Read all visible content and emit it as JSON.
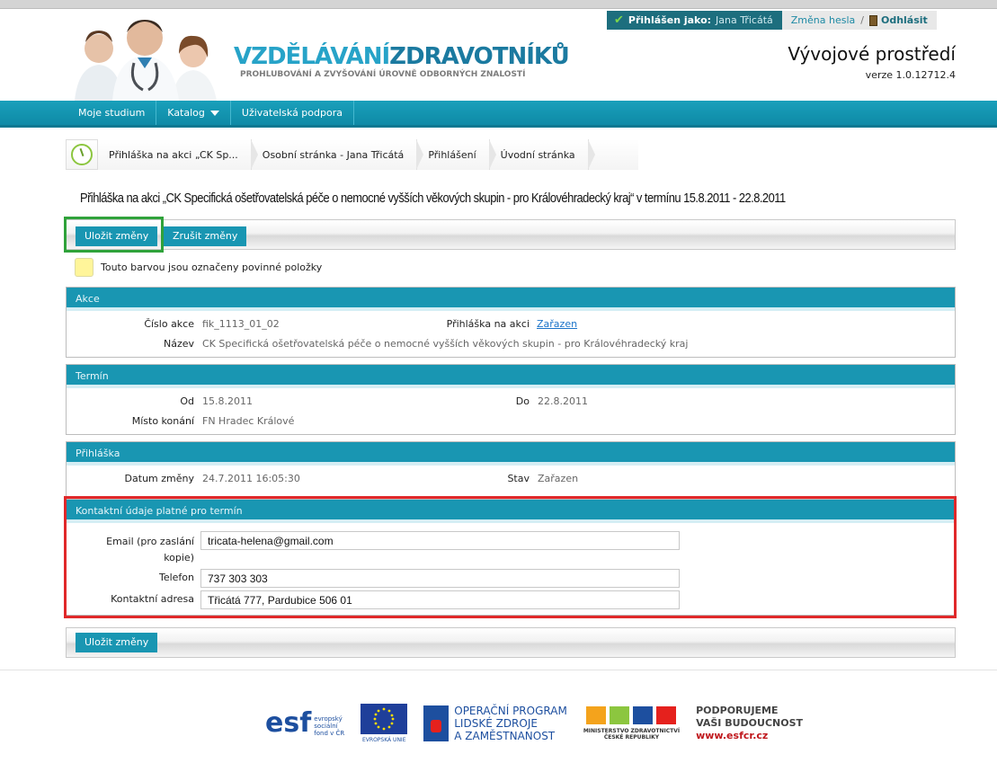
{
  "header": {
    "logged_prefix": "Přihlášen jako:",
    "logged_user": "Jana Třicátá",
    "change_password": "Změna hesla",
    "separator": "/",
    "logout": "Odhlásit",
    "brand_title_a": "VZDĚLÁVÁNÍ",
    "brand_title_b": "ZDRAVOTNÍKŮ",
    "brand_subtitle": "PROHLUBOVÁNÍ A ZVYŠOVÁNÍ ÚROVNĚ ODBORNÝCH ZNALOSTÍ",
    "environment": "Vývojové prostředí",
    "version": "verze 1.0.12712.4"
  },
  "nav": {
    "items": [
      "Moje studium",
      "Katalog",
      "Uživatelská podpora"
    ]
  },
  "breadcrumb": {
    "items": [
      "Přihláška na akci „CK Sp...",
      "Osobní stránka - Jana Třicátá",
      "Přihlášení",
      "Úvodní stránka"
    ]
  },
  "page": {
    "title": "Přihláška na akci „CK Specifická ošetřovatelská péče o nemocné vyšších věkových skupin - pro Královéhradecký kraj“ v termínu 15.8.2011 - 22.8.2011"
  },
  "toolbar": {
    "save_label": "Uložit změny",
    "cancel_label": "Zrušit změny"
  },
  "legend": {
    "text": "Touto barvou jsou označeny povinné položky",
    "color": "#fff59a"
  },
  "akce": {
    "header": "Akce",
    "cislo_label": "Číslo akce",
    "cislo_value": "fik_1113_01_02",
    "prihlaska_label": "Přihláška na akci",
    "prihlaska_value": "Zařazen",
    "nazev_label": "Název",
    "nazev_value": "CK  Specifická ošetřovatelská péče o nemocné vyšších věkových skupin - pro Královéhradecký kraj"
  },
  "termin": {
    "header": "Termín",
    "od_label": "Od",
    "od_value": "15.8.2011",
    "do_label": "Do",
    "do_value": "22.8.2011",
    "misto_label": "Místo konání",
    "misto_value": "FN Hradec Králové"
  },
  "prihlaska": {
    "header": "Přihláška",
    "datum_label": "Datum změny",
    "datum_value": "24.7.2011 16:05:30",
    "stav_label": "Stav",
    "stav_value": "Zařazen"
  },
  "kontakt": {
    "header": "Kontaktní údaje platné pro termín",
    "email_label_1": "Email (pro zaslání",
    "email_label_2": "kopie)",
    "email_value": "tricata-helena@gmail.com",
    "telefon_label": "Telefon",
    "telefon_value": "737 303 303",
    "adresa_label": "Kontaktní adresa",
    "adresa_value": "Třicátá 777, Pardubice 506 01"
  },
  "footer": {
    "esf_mark": "esf",
    "esf_text_1": "evropský",
    "esf_text_2": "sociální",
    "esf_text_3": "fond v ČR",
    "eu_caption": "EVROPSKÁ UNIE",
    "op_line_1": "OPERAČNÍ PROGRAM",
    "op_line_2": "LIDSKÉ ZDROJE",
    "op_line_3": "A ZAMĚSTNANOST",
    "mz_caption_1": "MINISTERSTVO ZDRAVOTNICTVÍ",
    "mz_caption_2": "ČESKÉ REPUBLIKY",
    "support_1": "PODPORUJEME",
    "support_2": "VAŠI BUDOUCNOST",
    "support_url": "www.esfcr.cz"
  },
  "colors": {
    "accent": "#1996b2",
    "highlight_green": "#2fa23a",
    "highlight_red": "#e0282a"
  }
}
